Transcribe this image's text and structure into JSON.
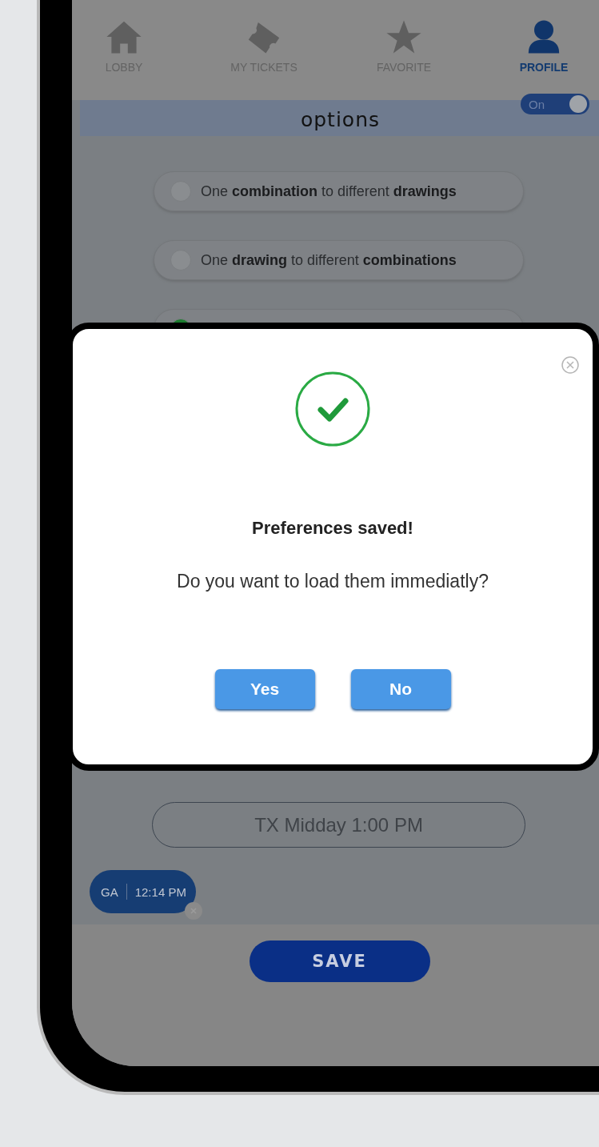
{
  "nav": [
    {
      "label": "LOBBY",
      "selected": false
    },
    {
      "label": "MY TICKETS",
      "selected": false
    },
    {
      "label": "FAVORITE",
      "selected": false
    },
    {
      "label": "PROFILE",
      "selected": true
    }
  ],
  "header": {
    "title": "options",
    "toggle": {
      "label": "On",
      "on": true
    }
  },
  "options": [
    {
      "text": "One **combination** to different **drawings**",
      "selected": false
    },
    {
      "text": "One **drawing** to different **combinations**",
      "selected": false
    },
    {
      "selected": true
    }
  ],
  "draw_field": {
    "placeholder": "TX Midday 1:00 PM"
  },
  "chip": {
    "state": "GA",
    "time": "12:14 PM"
  },
  "save_button": "SAVE",
  "dialog": {
    "title": "Preferences saved!",
    "message": "Do you want to load them immediatly?",
    "buttons": [
      "Yes",
      "No"
    ]
  }
}
